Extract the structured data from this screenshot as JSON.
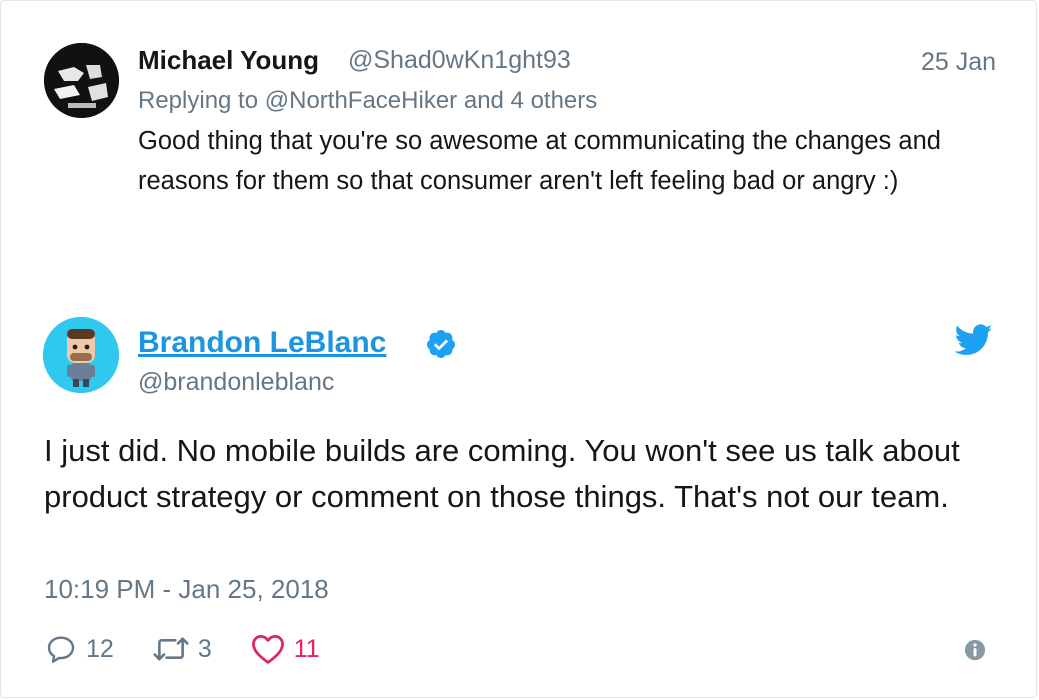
{
  "parent_tweet": {
    "author_name": "Michael Young",
    "author_handle": "@Shad0wKn1ght93",
    "date": "25 Jan",
    "replying_prefix": "Replying to ",
    "replying_mention": "@NorthFaceHiker",
    "replying_suffix": " and 4 others",
    "text": "Good thing that you're so awesome at communicating the changes and reasons for them so that consumer aren't left feeling bad or angry :)"
  },
  "main_tweet": {
    "author_name": "Brandon LeBlanc",
    "author_handle": "@brandonleblanc",
    "text": "I just did. No mobile builds are coming. You won't see us talk about product strategy or comment on those things. That's not our team.",
    "timestamp": "10:19 PM - Jan 25, 2018",
    "actions": {
      "replies": "12",
      "retweets": "3",
      "likes": "11"
    }
  },
  "icons": {
    "verified": "verified-badge-icon",
    "brand": "twitter-bird-icon",
    "reply": "reply-icon",
    "retweet": "retweet-icon",
    "like": "heart-icon",
    "info": "info-icon"
  },
  "colors": {
    "link_blue": "#1b95e0",
    "muted_gray": "#657786",
    "like_red": "#e0245e",
    "text_dark": "#14171a",
    "avatar_cyan": "#2fc9ef"
  }
}
